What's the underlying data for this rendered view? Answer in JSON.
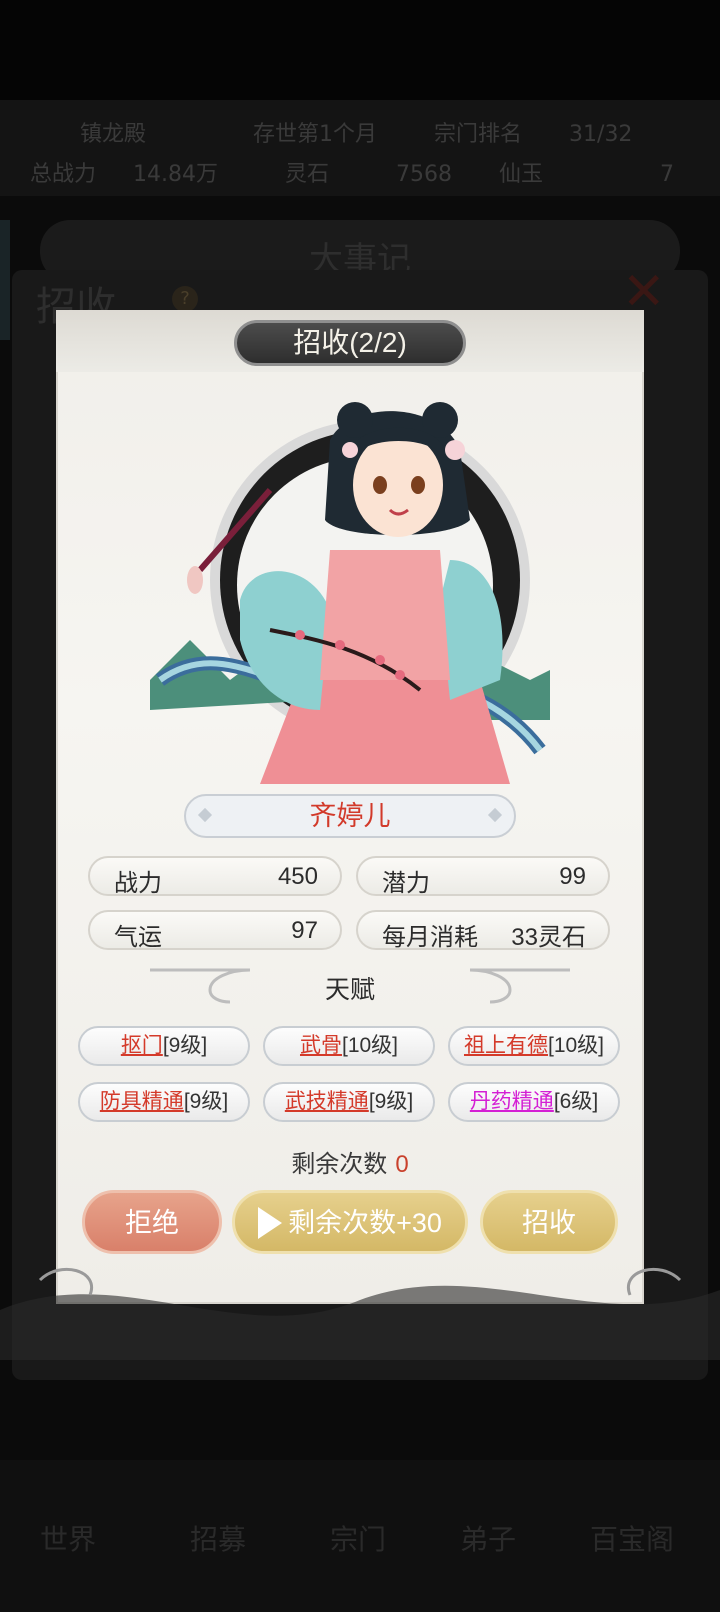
{
  "background": {
    "stats_row1": [
      "镇龙殿",
      "存世第1个月",
      "宗门排名",
      "31/32"
    ],
    "stats_row2": [
      "总战力",
      "14.84万",
      "灵石",
      "7568",
      "仙玉",
      "7"
    ],
    "header_title": "大事记",
    "panel_title": "招收",
    "nav_items": [
      "世界",
      "招募",
      "宗门",
      "弟子",
      "百宝阁"
    ]
  },
  "dialog": {
    "title": "招收(2/2)",
    "name": "齐婷儿",
    "stats": [
      {
        "label": "战力",
        "value": "450"
      },
      {
        "label": "潜力",
        "value": "99"
      },
      {
        "label": "气运",
        "value": "97"
      },
      {
        "label": "每月消耗",
        "value": "33灵石"
      }
    ],
    "talent_heading": "天赋",
    "talents": [
      {
        "name": "抠门",
        "level": "[9级]",
        "color": "#d43a2a"
      },
      {
        "name": "武骨",
        "level": "[10级]",
        "color": "#d43a2a"
      },
      {
        "name": "祖上有德",
        "level": "[10级]",
        "color": "#d43a2a"
      },
      {
        "name": "防具精通",
        "level": "[9级]",
        "color": "#d43a2a"
      },
      {
        "name": "武技精通",
        "level": "[9级]",
        "color": "#d43a2a"
      },
      {
        "name": "丹药精通",
        "level": "[6级]",
        "color": "#d41fd4"
      }
    ],
    "remain_label": "剩余次数",
    "remain_count": "0",
    "buttons": {
      "reject": "拒绝",
      "ad": "剩余次数+30",
      "accept": "招收"
    }
  },
  "colors": {
    "accent_red": "#d43a2a",
    "talent_purple": "#d41fd4",
    "button_gold": "#d4b866",
    "button_salmon": "#d9806a"
  }
}
